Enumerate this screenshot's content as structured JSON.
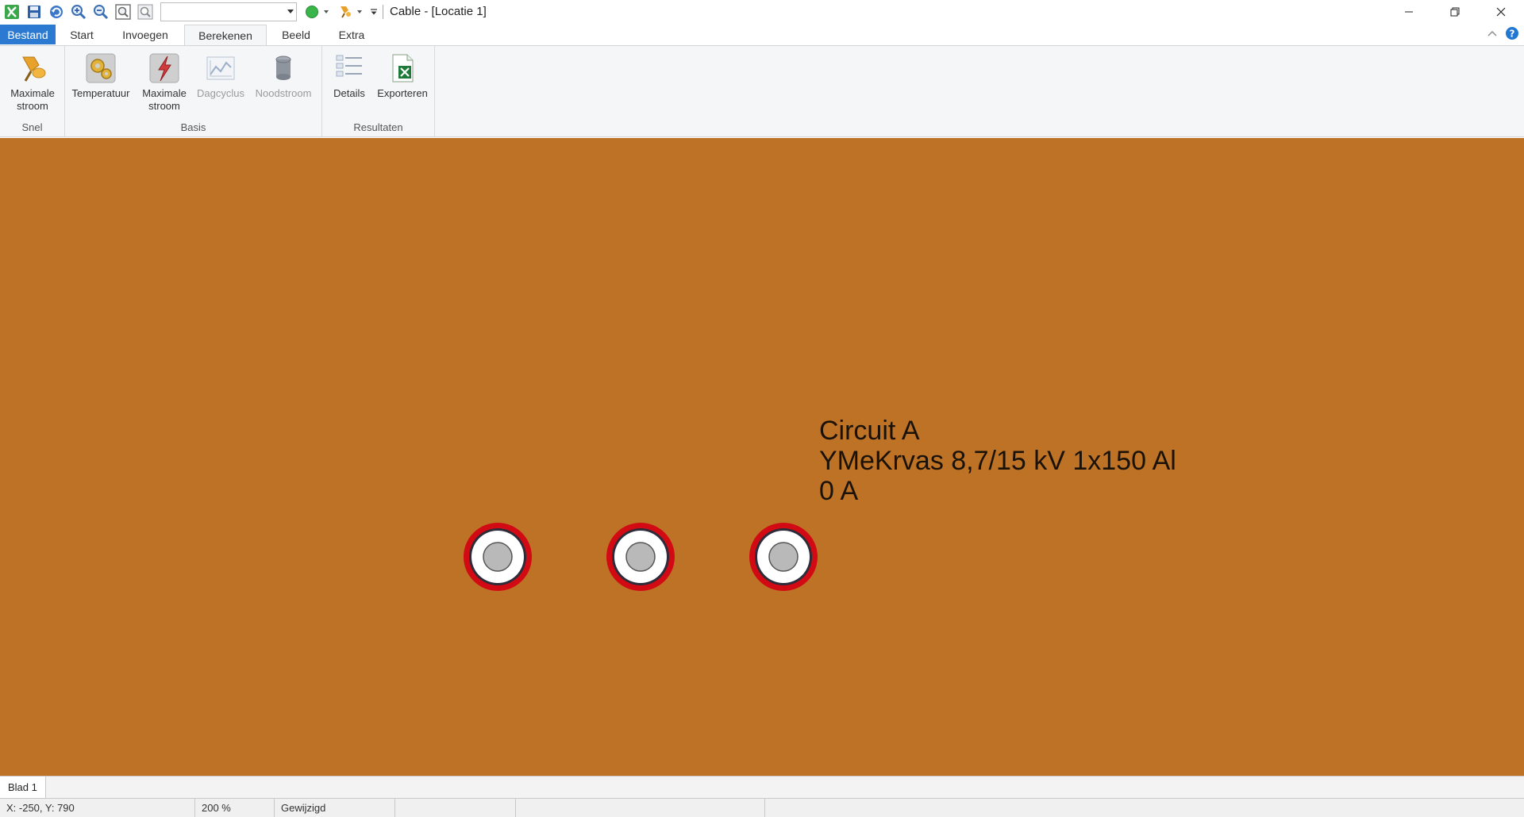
{
  "window": {
    "title": "Cable - [Locatie 1]"
  },
  "quick_access": {
    "icons": [
      "app-icon",
      "save-icon",
      "undo-icon",
      "zoom-in-icon",
      "zoom-out-icon",
      "zoom-fit-icon",
      "zoom-select-icon",
      "status-circle-icon",
      "pushpin-icon",
      "customize-icon"
    ],
    "combo_value": ""
  },
  "tabs": [
    {
      "label": "Bestand"
    },
    {
      "label": "Start"
    },
    {
      "label": "Invoegen"
    },
    {
      "label": "Berekenen"
    },
    {
      "label": "Beeld"
    },
    {
      "label": "Extra"
    }
  ],
  "active_tab": "Berekenen",
  "ribbon": {
    "groups": {
      "snel": {
        "label": "Snel",
        "buttons": [
          {
            "label": "Maximale\nstroom",
            "icon": "pushpin-icon"
          }
        ]
      },
      "basis": {
        "label": "Basis",
        "buttons": [
          {
            "label": "Temperatuur",
            "icon": "gears-icon"
          },
          {
            "label": "Maximale\nstroom",
            "icon": "lightning-icon"
          },
          {
            "label": "Dagcyclus",
            "icon": "chart-icon",
            "disabled": true
          },
          {
            "label": "Noodstroom",
            "icon": "cylinder-icon",
            "disabled": true
          }
        ]
      },
      "resultaten": {
        "label": "Resultaten",
        "buttons": [
          {
            "label": "Details",
            "icon": "details-list-icon"
          },
          {
            "label": "Exporteren",
            "icon": "excel-export-icon"
          }
        ]
      }
    }
  },
  "canvas": {
    "background": "#bd7226",
    "circuit_label": {
      "line1": "Circuit A",
      "line2": "YMeKrvas 8,7/15 kV 1x150 Al",
      "line3": "0 A"
    },
    "cables": [
      {
        "name": "cable-1"
      },
      {
        "name": "cable-2"
      },
      {
        "name": "cable-3"
      }
    ]
  },
  "sheets": [
    {
      "label": "Blad 1"
    }
  ],
  "statusbar": {
    "coords": "X: -250, Y: 790",
    "zoom": "200 %",
    "state": "Gewijzigd"
  },
  "colors": {
    "accent": "#2b79d0",
    "cable_outer": "#d10a14",
    "cable_insulation": "#2c2c3a",
    "cable_core": "#b9b9b9"
  }
}
